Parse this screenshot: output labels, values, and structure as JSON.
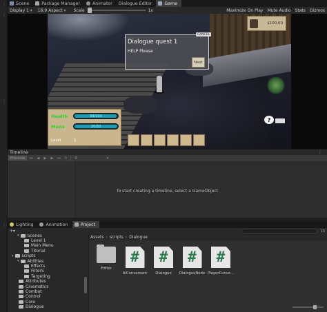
{
  "editor_tabs": [
    {
      "label": "Scene",
      "icon": "scene-icon"
    },
    {
      "label": "Package Manager",
      "icon": "package-icon"
    },
    {
      "label": "Animator",
      "icon": "animator-icon"
    },
    {
      "label": "Dialogue Editor",
      "icon": ""
    },
    {
      "label": "Game",
      "icon": "game-icon"
    }
  ],
  "game_toolbar": {
    "display": "Display 1",
    "aspect": "16:9 Aspect",
    "scale_label": "Scale",
    "scale_value": "1x",
    "scale_fraction": 0.0,
    "maximize": "Maximize On Play",
    "mute": "Mute Audio",
    "stats": "Stats",
    "gizmos": "Gizmos"
  },
  "game": {
    "dialogue": {
      "title": "Dialogue quest 1",
      "body": "HELP Please",
      "next": "Next",
      "cancel": "CANCEL"
    },
    "gold": "$100.00",
    "help_icon": "?",
    "stats": {
      "health_label": "Health",
      "health_value": "99/100",
      "health_fraction": 0.99,
      "mana_label": "Mana",
      "mana_value": "20/20",
      "mana_fraction": 1.0,
      "level_label": "Level",
      "level_value": "1"
    },
    "slot_count": 6
  },
  "timeline": {
    "title": "Timeline",
    "preview": "Preview",
    "frame": "0",
    "empty_message": "To start creating a timeline, select a GameObject"
  },
  "bottom_tabs": [
    {
      "label": "Lighting",
      "icon": "lighting-icon"
    },
    {
      "label": "Animation",
      "icon": "animation-icon"
    },
    {
      "label": "Project",
      "icon": "project-icon"
    }
  ],
  "project": {
    "asset_count": "13",
    "breadcrumb": [
      "Assets",
      "scripts",
      "Dialogue"
    ],
    "tree": [
      {
        "label": "Scenes",
        "depth": 2,
        "arrow": "▾"
      },
      {
        "label": "Level 1",
        "depth": 3,
        "arrow": ""
      },
      {
        "label": "Main Menu",
        "depth": 3,
        "arrow": ""
      },
      {
        "label": "Titorial",
        "depth": 3,
        "arrow": ""
      },
      {
        "label": "scripts",
        "depth": 1,
        "arrow": "▾"
      },
      {
        "label": "Abilities",
        "depth": 2,
        "arrow": "▾"
      },
      {
        "label": "Effects",
        "depth": 3,
        "arrow": ""
      },
      {
        "label": "FilterS",
        "depth": 3,
        "arrow": ""
      },
      {
        "label": "Targeting",
        "depth": 3,
        "arrow": ""
      },
      {
        "label": "Attributes",
        "depth": 2,
        "arrow": ""
      },
      {
        "label": "Cinematics",
        "depth": 2,
        "arrow": ""
      },
      {
        "label": "Combat",
        "depth": 2,
        "arrow": ""
      },
      {
        "label": "Control",
        "depth": 2,
        "arrow": ""
      },
      {
        "label": "Core",
        "depth": 2,
        "arrow": ""
      },
      {
        "label": "Dialogue",
        "depth": 2,
        "arrow": ""
      }
    ],
    "assets": [
      {
        "label": "Editor",
        "type": "folder"
      },
      {
        "label": "AIConversant",
        "type": "cs"
      },
      {
        "label": "Dialogue",
        "type": "cs"
      },
      {
        "label": "DialogueNode",
        "type": "cs"
      },
      {
        "label": "PlayerConve...",
        "type": "cs"
      }
    ]
  }
}
